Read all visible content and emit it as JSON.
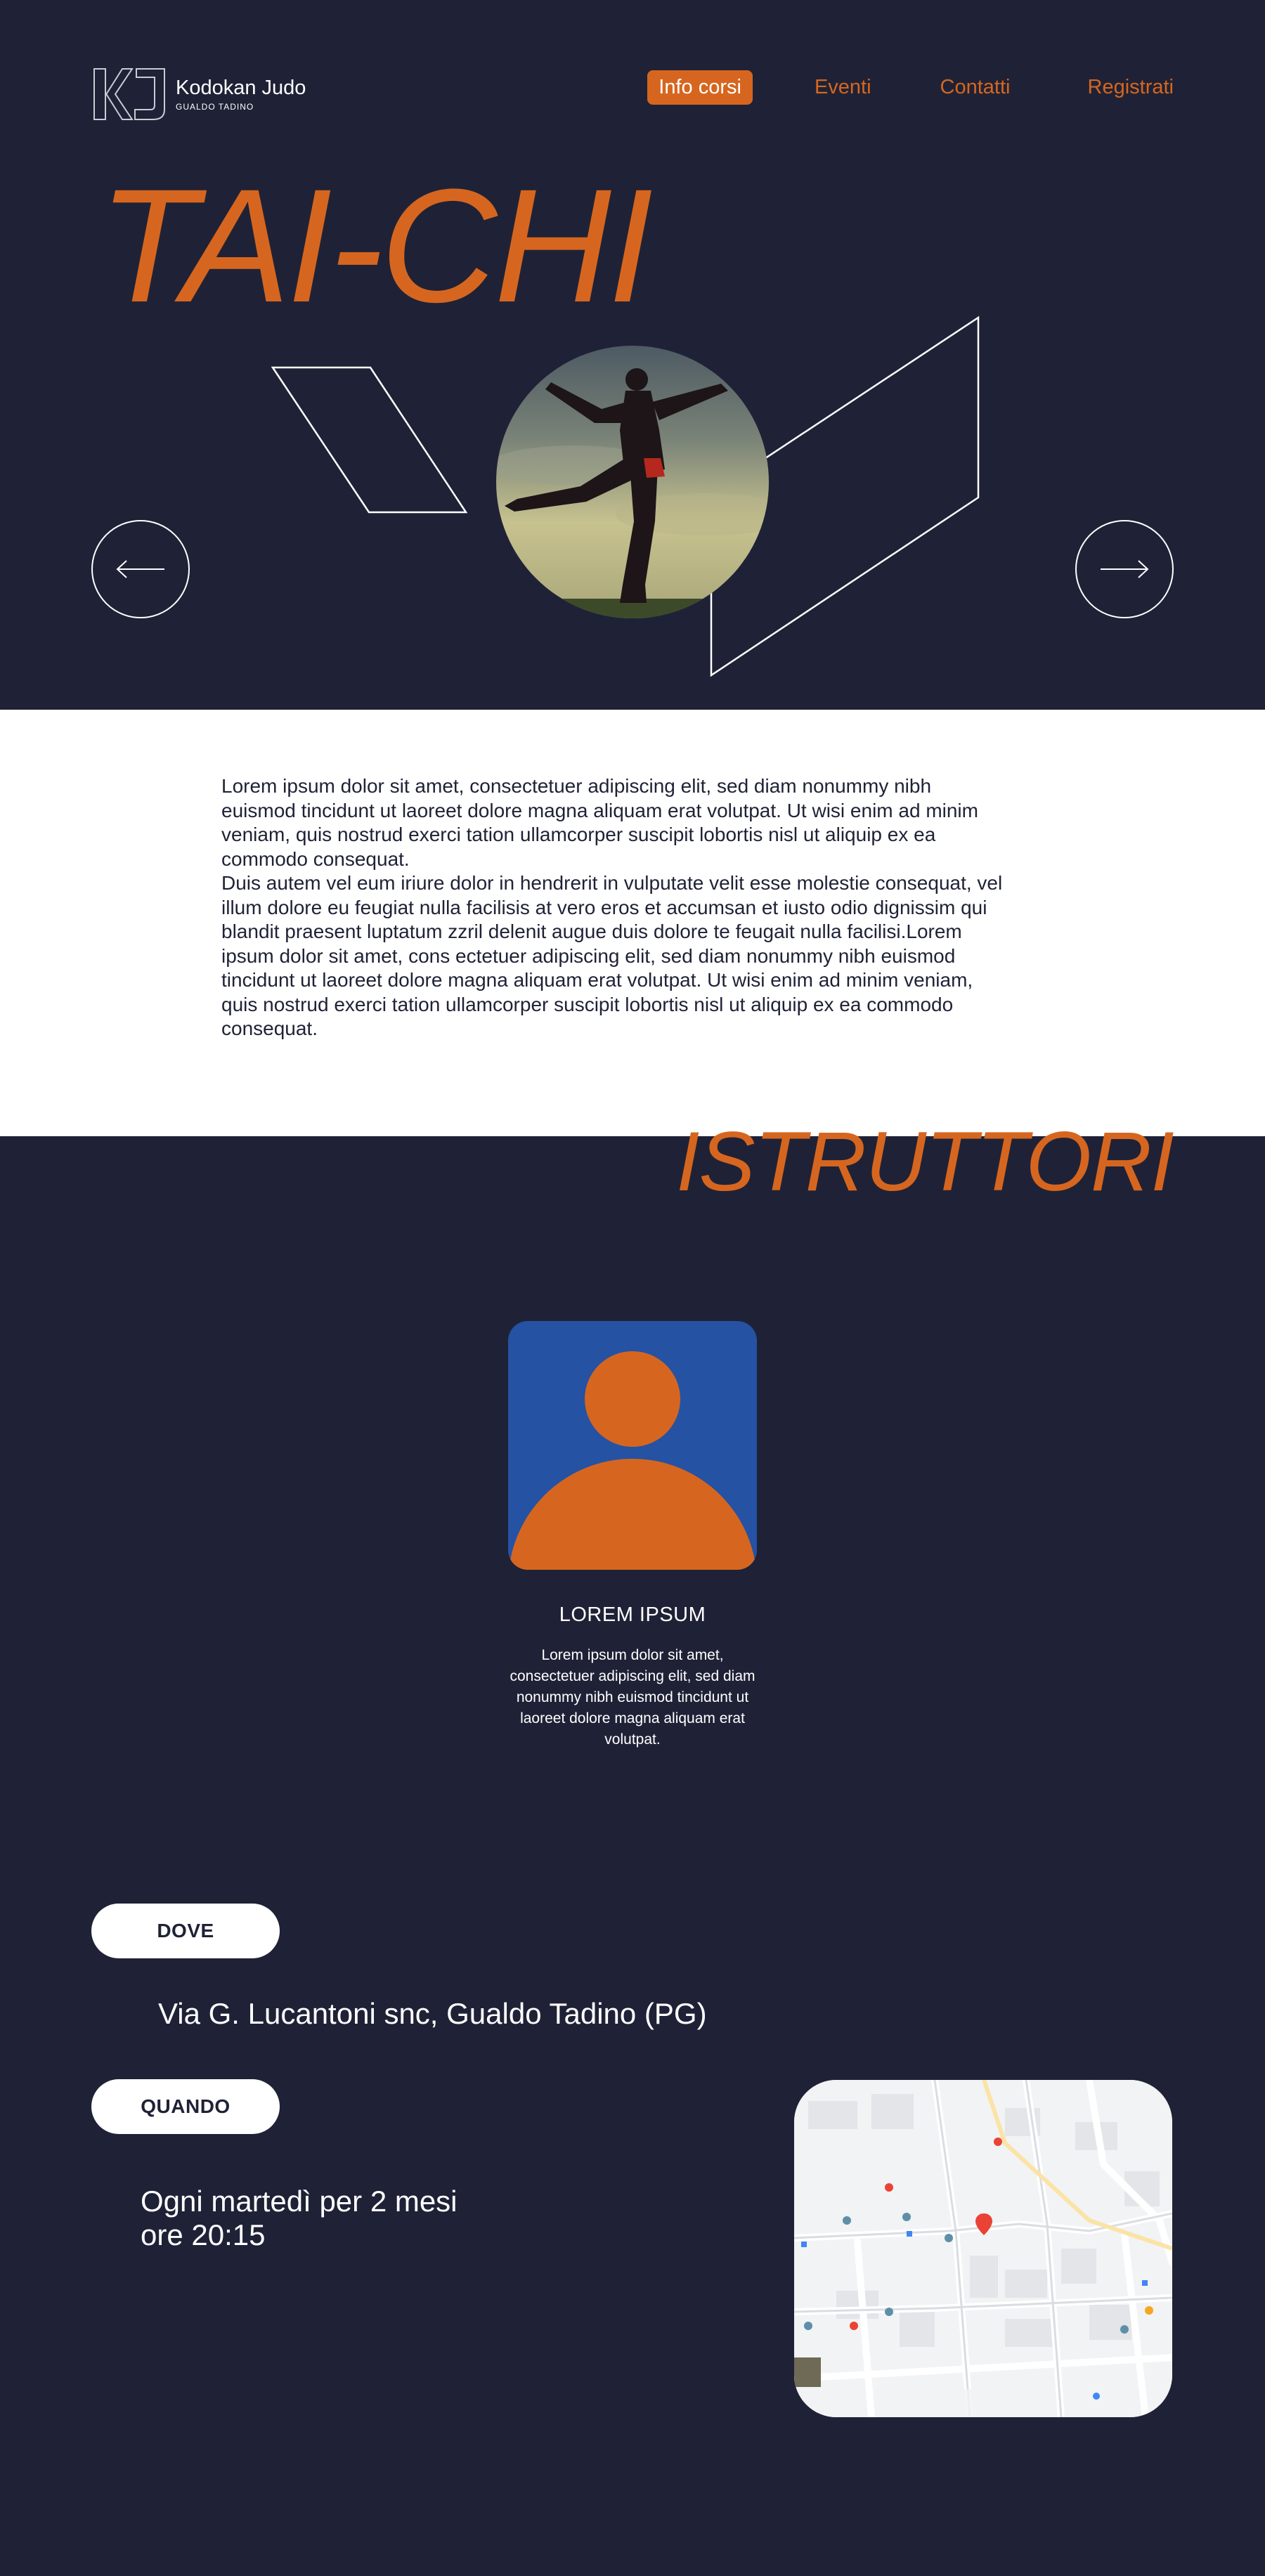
{
  "brand": {
    "name": "Kodokan Judo",
    "subtitle": "GUALDO TADINO"
  },
  "nav": {
    "items": [
      {
        "label": "Info corsi",
        "active": true
      },
      {
        "label": "Eventi",
        "active": false
      },
      {
        "label": "Contatti",
        "active": false
      },
      {
        "label": "Registrati",
        "active": false
      }
    ]
  },
  "hero": {
    "title": "TAI-CHI",
    "prev_icon": "arrow-left-icon",
    "next_icon": "arrow-right-icon"
  },
  "intro": {
    "text": "Lorem ipsum dolor sit amet, consectetuer adipiscing elit, sed diam nonummy nibh\neuismod tincidunt ut laoreet dolore magna aliquam erat volutpat. Ut wisi enim ad minim\nveniam, quis nostrud exerci tation ullamcorper suscipit lobortis nisl ut aliquip ex ea\ncommodo consequat.\nDuis autem vel eum iriure dolor in hendrerit in vulputate velit esse molestie consequat, vel\nillum dolore eu feugiat nulla facilisis at vero eros et accumsan et iusto odio dignissim qui\nblandit praesent luptatum zzril delenit augue duis dolore te feugait nulla facilisi.Lorem\nipsum dolor sit amet, cons ectetuer adipiscing elit, sed diam nonummy nibh euismod\ntincidunt ut laoreet dolore magna aliquam erat volutpat. Ut wisi enim ad minim veniam,\nquis nostrud exerci tation ullamcorper suscipit lobortis nisl ut aliquip ex ea commodo\nconsequat."
  },
  "instructors": {
    "title": "ISTRUTTORI",
    "items": [
      {
        "name": "LOREM IPSUM",
        "bio": "Lorem ipsum dolor sit amet, consectetuer adipiscing elit, sed diam nonummy nibh euismod tincidunt ut laoreet dolore magna aliquam erat volutpat."
      }
    ]
  },
  "info": {
    "where_label": "DOVE",
    "address": "Via G. Lucantoni snc, Gualdo Tadino (PG)",
    "when_label": "QUANDO",
    "when_line1": "Ogni martedì per 2 mesi",
    "when_line2": "ore 20:15"
  },
  "colors": {
    "background": "#1f2236",
    "accent": "#d6661f",
    "avatar_bg": "#2552a3",
    "text_light": "#ffffff"
  }
}
